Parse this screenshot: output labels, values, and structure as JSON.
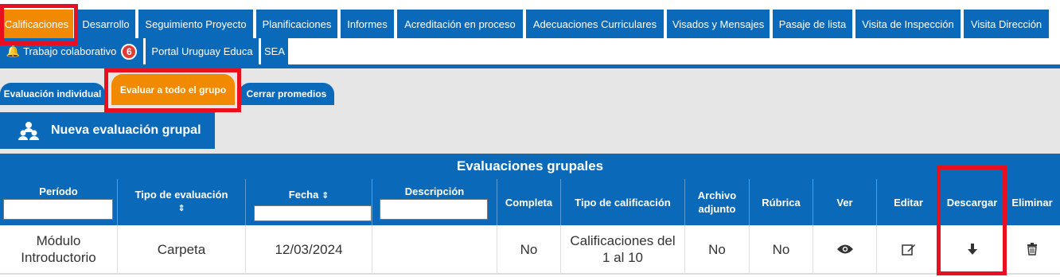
{
  "nav": {
    "row1": [
      "Calificaciones",
      "Desarrollo",
      "Seguimiento Proyecto",
      "Planificaciones",
      "Informes",
      "Acreditación en proceso",
      "Adecuaciones Curriculares",
      "Visados y Mensajes",
      "Pasaje de lista",
      "Visita de Inspección",
      "Visita Dirección"
    ],
    "row2": {
      "collab_label": "Trabajo colaborativo",
      "collab_badge": "6",
      "portal": "Portal Uruguay Educa",
      "sea": "SEA"
    }
  },
  "subtabs": [
    "Evaluación individual",
    "Evaluar a todo el grupo",
    "Cerrar promedios"
  ],
  "new_button": {
    "label": "Nueva evaluación grupal",
    "icon": "group-icon"
  },
  "table": {
    "title": "Evaluaciones grupales",
    "headers": {
      "periodo": "Período",
      "tipo_eval": "Tipo de evaluación",
      "fecha": "Fecha",
      "descripcion": "Descripción",
      "completa": "Completa",
      "tipo_calif": "Tipo de calificación",
      "archivo": "Archivo adjunto",
      "rubrica": "Rúbrica",
      "ver": "Ver",
      "editar": "Editar",
      "descargar": "Descargar",
      "eliminar": "Eliminar"
    },
    "rows": [
      {
        "periodo": "Módulo Introductorio",
        "tipo_eval": "Carpeta",
        "fecha": "12/03/2024",
        "descripcion": "",
        "completa": "No",
        "tipo_calif": "Calificaciones del 1 al 10",
        "archivo": "No",
        "rubrica": "No"
      }
    ]
  },
  "colors": {
    "primary": "#0a6ab9",
    "accent": "#f18a00",
    "highlight": "#e8101f",
    "badge": "#e53935"
  }
}
